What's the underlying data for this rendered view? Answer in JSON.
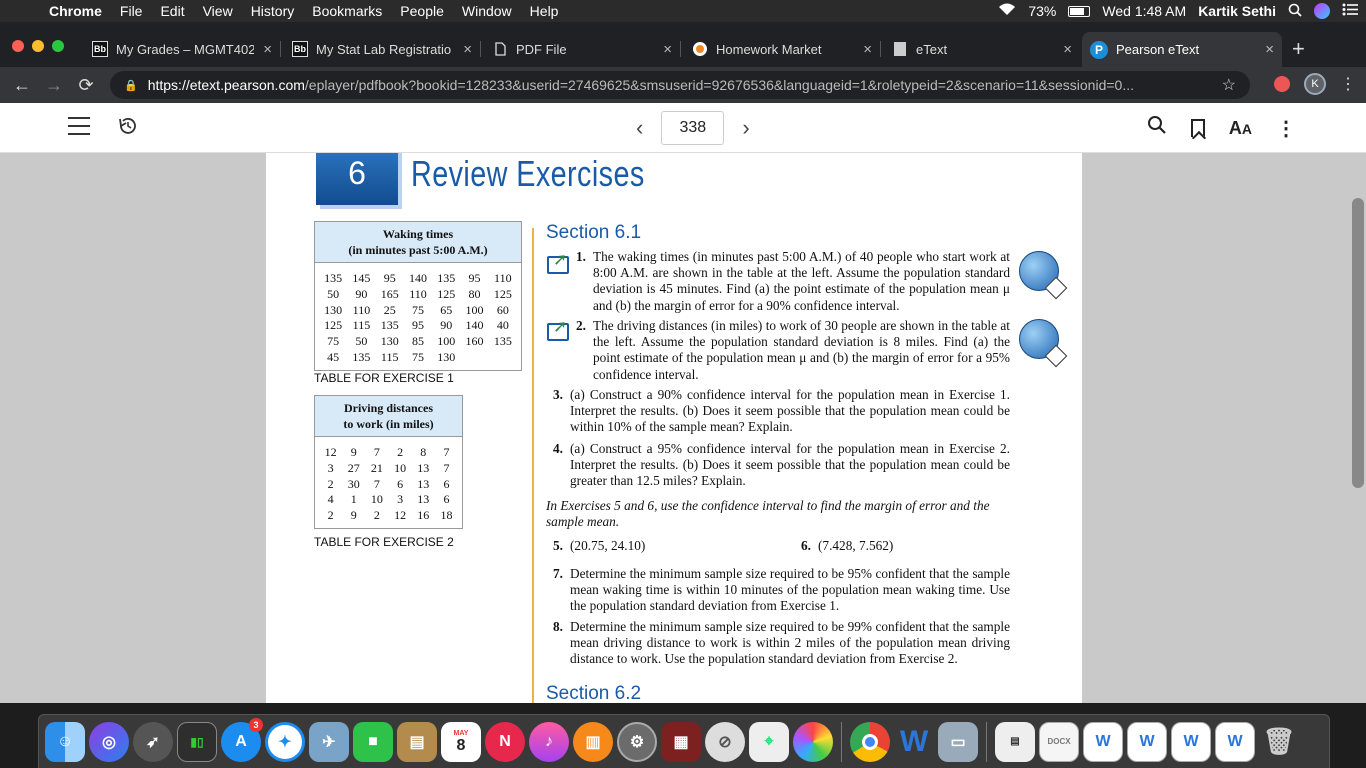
{
  "menubar": {
    "app": "Chrome",
    "items": [
      "File",
      "Edit",
      "View",
      "History",
      "Bookmarks",
      "People",
      "Window",
      "Help"
    ],
    "battery": "73%",
    "clock": "Wed 1:48 AM",
    "user": "Kartik Sethi"
  },
  "tabs": [
    {
      "label": "My Grades – MGMT402",
      "favicon": "Bb"
    },
    {
      "label": "My Stat Lab Registratio",
      "favicon": "Bb"
    },
    {
      "label": "PDF File",
      "favicon": "doc-icon"
    },
    {
      "label": "Homework Market",
      "favicon": "hm-icon"
    },
    {
      "label": "eText",
      "favicon": "page-icon"
    },
    {
      "label": "Pearson eText",
      "favicon": "P",
      "active": true
    }
  ],
  "address": {
    "host": "https://etext.pearson.com",
    "path": "/eplayer/pdfbook?bookid=128233&userid=27469625&smsuserid=92676536&languageid=1&roletypeid=2&scenario=11&sessionid=0...",
    "profile_initial": "K"
  },
  "reader": {
    "page_number": "338"
  },
  "book": {
    "chapter_number": "6",
    "chapter_title": "Review Exercises",
    "table1": {
      "header_line1": "Waking times",
      "header_line2": "(in minutes past 5:00 A.M.)",
      "rows": [
        [
          "135",
          "145",
          "95",
          "140",
          "135",
          "95",
          "110"
        ],
        [
          "50",
          "90",
          "165",
          "110",
          "125",
          "80",
          "125"
        ],
        [
          "130",
          "110",
          "25",
          "75",
          "65",
          "100",
          "60"
        ],
        [
          "125",
          "115",
          "135",
          "95",
          "90",
          "140",
          "40"
        ],
        [
          "75",
          "50",
          "130",
          "85",
          "100",
          "160",
          "135"
        ],
        [
          "45",
          "135",
          "115",
          "75",
          "130",
          "",
          ""
        ]
      ],
      "caption": "TABLE FOR EXERCISE 1"
    },
    "table2": {
      "header_line1": "Driving distances",
      "header_line2": "to work (in miles)",
      "rows": [
        [
          "12",
          "9",
          "7",
          "2",
          "8",
          "7"
        ],
        [
          "3",
          "27",
          "21",
          "10",
          "13",
          "7"
        ],
        [
          "2",
          "30",
          "7",
          "6",
          "13",
          "6"
        ],
        [
          "4",
          "1",
          "10",
          "3",
          "13",
          "6"
        ],
        [
          "2",
          "9",
          "2",
          "12",
          "16",
          "18"
        ]
      ],
      "caption": "TABLE FOR EXERCISE 2"
    },
    "section1": "Section 6.1",
    "section2": "Section 6.2",
    "exercises": {
      "e1_num": "1.",
      "e1": "The waking times (in minutes past 5:00 A.M.) of 40 people who start work at 8:00 A.M. are shown in the table at the left. Assume the population standard deviation is 45 minutes. Find (a) the point estimate of the population mean μ and (b) the margin of error for a 90% confidence interval.",
      "e2_num": "2.",
      "e2": "The driving distances (in miles) to work of 30 people are shown in the table at the left. Assume the population standard deviation is 8 miles. Find (a) the point estimate of the population mean μ and (b) the margin of error for a 95% confidence interval.",
      "e3_num": "3.",
      "e3": "(a) Construct a 90% confidence interval for the population mean in Exercise 1. Interpret the results. (b) Does it seem possible that the population mean could be within 10% of the sample mean? Explain.",
      "e4_num": "4.",
      "e4": "(a) Construct a 95% confidence interval for the population mean in Exercise 2. Interpret the results. (b) Does it seem possible that the population mean could be greater than 12.5 miles? Explain.",
      "instruction": "In Exercises 5 and 6, use the confidence interval to find the margin of error and the sample mean.",
      "e5_num": "5.",
      "e5": "(20.75, 24.10)",
      "e6_num": "6.",
      "e6": "(7.428, 7.562)",
      "e7_num": "7.",
      "e7": "Determine the minimum sample size required to be 95% confident that the sample mean waking time is within 10 minutes of the population mean waking time. Use the population standard deviation from Exercise 1.",
      "e8_num": "8.",
      "e8": "Determine the minimum sample size required to be 99% confident that the sample mean driving distance to work is within 2 miles of the population mean driving distance to work. Use the population standard deviation from Exercise 2."
    }
  },
  "dock": {
    "appstore_badge": "3",
    "calendar_month": "MAY",
    "calendar_day": "8"
  },
  "colors": {
    "accent": "#1a5aa6",
    "rule": "#f0b23c",
    "table_header": "#d8e9f7"
  }
}
